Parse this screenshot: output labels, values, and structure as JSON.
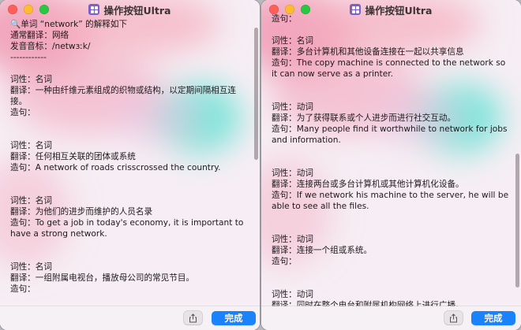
{
  "app_title": "操作按钮Ultra",
  "done_label": "完成",
  "colors": {
    "accent": "#1a82fb",
    "pink": "#f2a1b6",
    "teal": "#7ee6d6"
  },
  "icons": {
    "share": "share-icon",
    "app": "app-grid-icon"
  },
  "left_lines": [
    "🔍单词 “network” 的解释如下",
    "通常翻译：网络",
    "发音音标：/netwɜːk/",
    "------------",
    "",
    "词性：名词",
    "翻译：一种由纤维元素组成的织物或结构，以定期间隔相互连接。",
    "造句：",
    "",
    "",
    "词性：名词",
    "翻译：任何相互关联的团体或系统",
    "造句：A network of roads crisscrossed the country.",
    "",
    "",
    "词性：名词",
    "翻译：为他们的进步而维护的人员名录",
    "造句：To get a job in today's economy, it is important to have a strong network.",
    "",
    "",
    "词性：名词",
    "翻译：一组附属电视台，播放母公司的常见节目。",
    "造句："
  ],
  "right_lines": [
    "造句：",
    "",
    "词性：名词",
    "翻译：多台计算机和其他设备连接在一起以共享信息",
    "造句：The copy machine is connected to the network so it can now serve as a printer.",
    "",
    "",
    "词性：动词",
    "翻译：为了获得联系或个人进步而进行社交互动。",
    "造句：Many people find it worthwhile to network for jobs and information.",
    "",
    "",
    "词性：动词",
    "翻译：连接两台或多台计算机或其他计算机化设备。",
    "造句：If we network his machine to the server, he will be able to see all the files.",
    "",
    "",
    "词性：动词",
    "翻译：连接一个组或系统。",
    "造句：",
    "",
    "",
    "词性：动词",
    "翻译：同时在整个电台和附属机构网络上进行广播。"
  ]
}
